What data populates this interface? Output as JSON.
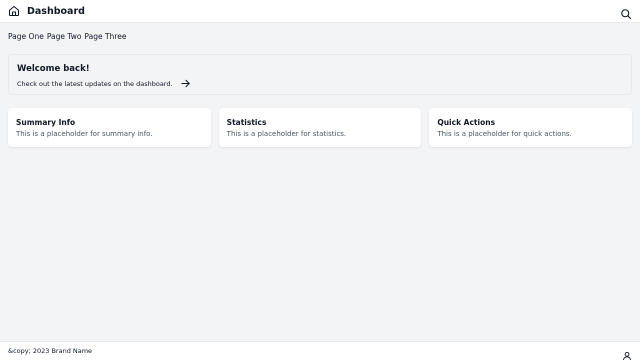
{
  "header": {
    "title": "Dashboard",
    "home_icon": "home-icon",
    "search_icon": "search-icon"
  },
  "nav": {
    "items": [
      "Page One",
      "Page Two",
      "Page Three"
    ]
  },
  "welcome": {
    "title": "Welcome back!",
    "text": "Check out the latest updates on the dashboard.",
    "arrow_icon": "arrow-right-icon"
  },
  "cards": [
    {
      "title": "Summary Info",
      "text": "This is a placeholder for summary info."
    },
    {
      "title": "Statistics",
      "text": "This is a placeholder for statistics."
    },
    {
      "title": "Quick Actions",
      "text": "This is a placeholder for quick actions."
    }
  ],
  "footer": {
    "copyright": "&copy; 2023 Brand Name",
    "user_icon": "user-icon"
  },
  "colors": {
    "background": "#f3f4f6",
    "surface": "#ffffff",
    "text": "#111827",
    "muted": "#4b5563",
    "border": "#e5e7eb"
  }
}
